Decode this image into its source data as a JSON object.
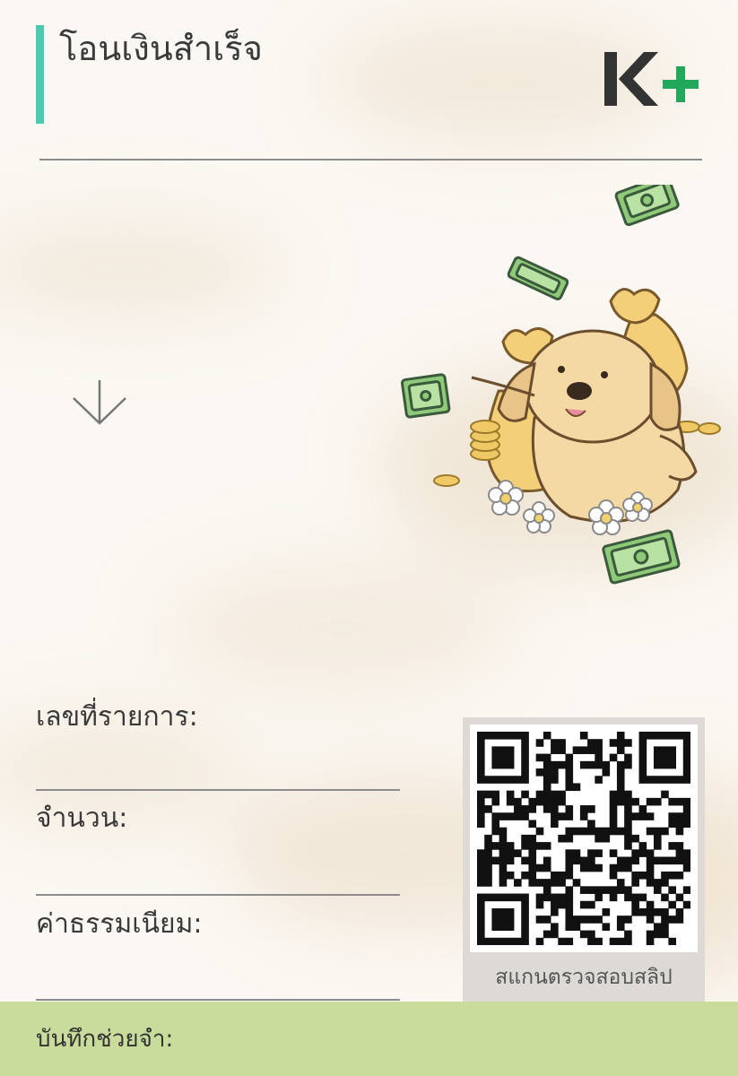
{
  "header": {
    "title": "โอนเงินสำเร็จ",
    "logo_text": "K+",
    "accent_color": "#4fc9b0",
    "logo_colors": {
      "k": "#333333",
      "plus": "#22a85a"
    }
  },
  "illustration": {
    "subject": "dog-with-money-bags-and-banknotes"
  },
  "fields": {
    "transaction_id_label": "เลขที่รายการ:",
    "amount_label": "จำนวน:",
    "fee_label": "ค่าธรรมเนียม:"
  },
  "qr": {
    "caption": "สแกนตรวจสอบสลิป"
  },
  "memo": {
    "label": "บันทึกช่วยจำ:",
    "bar_color": "#c9dc9c"
  }
}
